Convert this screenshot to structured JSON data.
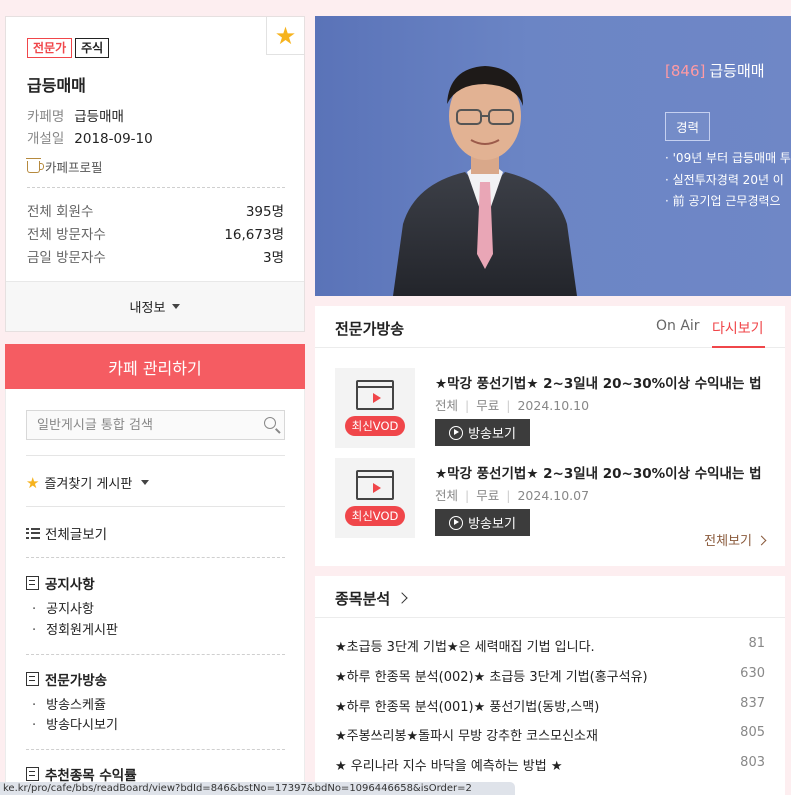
{
  "profile": {
    "badges": [
      "전문가",
      "주식"
    ],
    "cafe_name": "급등매매",
    "name_label": "카페명",
    "name_value": "급등매매",
    "date_label": "개설일",
    "date_value": "2018-09-10",
    "profile_link": "카페프로필",
    "stats": [
      {
        "label": "전체 회원수",
        "value": "395명"
      },
      {
        "label": "전체 방문자수",
        "value": "16,673명"
      },
      {
        "label": "금일 방문자수",
        "value": "3명"
      }
    ],
    "my_info": "내정보"
  },
  "manage_button": "카페 관리하기",
  "search": {
    "placeholder": "일반게시글 통합 검색"
  },
  "menu": {
    "favorites": "즐겨찾기 게시판",
    "all_posts": "전체글보기",
    "groups": [
      {
        "title": "공지사항",
        "items": [
          "공지사항",
          "정회원게시판"
        ]
      },
      {
        "title": "전문가방송",
        "items": [
          "방송스케쥴",
          "방송다시보기"
        ]
      },
      {
        "title": "추천종목 수익률",
        "items": []
      }
    ]
  },
  "banner": {
    "code": "[846]",
    "title": "급등매매",
    "career_tag": "경력",
    "career_lines": [
      "· '09년 부터 급등매매 투",
      "· 실전투자경력 20년 이",
      "· 前 공기업 근무경력으"
    ]
  },
  "broadcast": {
    "title": "전문가방송",
    "tabs": [
      "On Air",
      "다시보기"
    ],
    "active_tab": "다시보기",
    "items": [
      {
        "badge": "최신VOD",
        "title": "★막강 풍선기법★ 2~3일내 20~30%이상 수익내는 법",
        "category": "전체",
        "price": "무료",
        "date": "2024.10.10",
        "button": "방송보기"
      },
      {
        "badge": "최신VOD",
        "title": "★막강 풍선기법★ 2~3일내 20~30%이상 수익내는 법",
        "category": "전체",
        "price": "무료",
        "date": "2024.10.07",
        "button": "방송보기"
      }
    ],
    "view_all": "전체보기"
  },
  "analysis": {
    "title": "종목분석",
    "posts": [
      {
        "title": "★초급등 3단계 기법★은 세력매집 기법 입니다.",
        "count": "81"
      },
      {
        "title": "★하루 한종목 분석(002)★ 초급등 3단계 기법(홍구석유)",
        "count": "630"
      },
      {
        "title": "★하루 한종목 분석(001)★ 풍선기법(동방,스맥)",
        "count": "837"
      },
      {
        "title": "★주봉쓰리봉★돌파시 무방 강추한 코스모신소재",
        "count": "805"
      },
      {
        "title": "★ 우리나라 지수 바닥을 예측하는 방법 ★",
        "count": "803"
      }
    ]
  },
  "status_url": "ke.kr/pro/cafe/bbs/readBoard/view?bdId=846&bstNo=17397&bdNo=1096446658&isOrder=2",
  "colors": {
    "accent": "#f0464a",
    "manage_bg": "#f55c62",
    "banner_bg": "#6b85c5",
    "page_bg": "#fdeef0"
  }
}
